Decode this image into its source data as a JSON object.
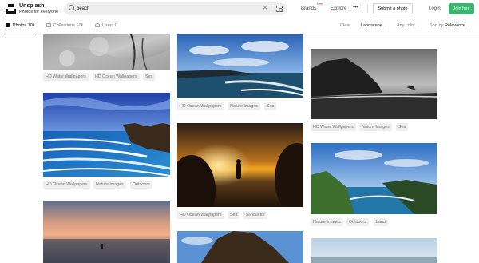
{
  "brand": {
    "name": "Unsplash",
    "tagline": "Photos for everyone"
  },
  "search": {
    "query": "beach"
  },
  "nav": {
    "brands": "Brands",
    "brands_badge": "New",
    "explore": "Explore",
    "more": "•••",
    "submit": "Submit a photo",
    "login": "Login",
    "join": "Join free"
  },
  "filters": {
    "tabs": [
      {
        "label": "Photos 10k",
        "active": true
      },
      {
        "label": "Collections 10k",
        "active": false
      },
      {
        "label": "Users 0",
        "active": false
      }
    ],
    "clear": "Clear",
    "orientation": "Landscape",
    "color": "Any color",
    "sort_prefix": "Sort by",
    "sort_value": "Relevance"
  },
  "columns": [
    {
      "items": [
        {
          "photo": "stormy-sea-spray",
          "tags": [
            "HD Water Wallpapers",
            "HD Ocean Wallpapers",
            "Sea"
          ]
        },
        {
          "photo": "blue-surf-cliffs",
          "tags": [
            "HD Ocean Wallpapers",
            "Nature Images",
            "Outdoors"
          ]
        },
        {
          "photo": "sunset-beach-walker",
          "tags": []
        }
      ]
    },
    {
      "items": [
        {
          "photo": "blue-sky-coastline",
          "tags": [
            "HD Ocean Wallpapers",
            "Nature Images",
            "Sea"
          ]
        },
        {
          "photo": "golden-sunset-silhouettes",
          "tags": [
            "HD Ocean Wallpapers",
            "Sea",
            "Silhouette"
          ]
        },
        {
          "photo": "rock-against-sky",
          "tags": []
        }
      ]
    },
    {
      "items": [
        {
          "photo": "monochrome-rock-beach",
          "tags": [
            "HD Water Wallpapers",
            "Nature Images",
            "Sea"
          ]
        },
        {
          "photo": "green-hill-bay",
          "tags": [
            "Nature Images",
            "Outdoors",
            "Land"
          ]
        },
        {
          "photo": "pale-sky-shore",
          "tags": []
        }
      ]
    }
  ]
}
